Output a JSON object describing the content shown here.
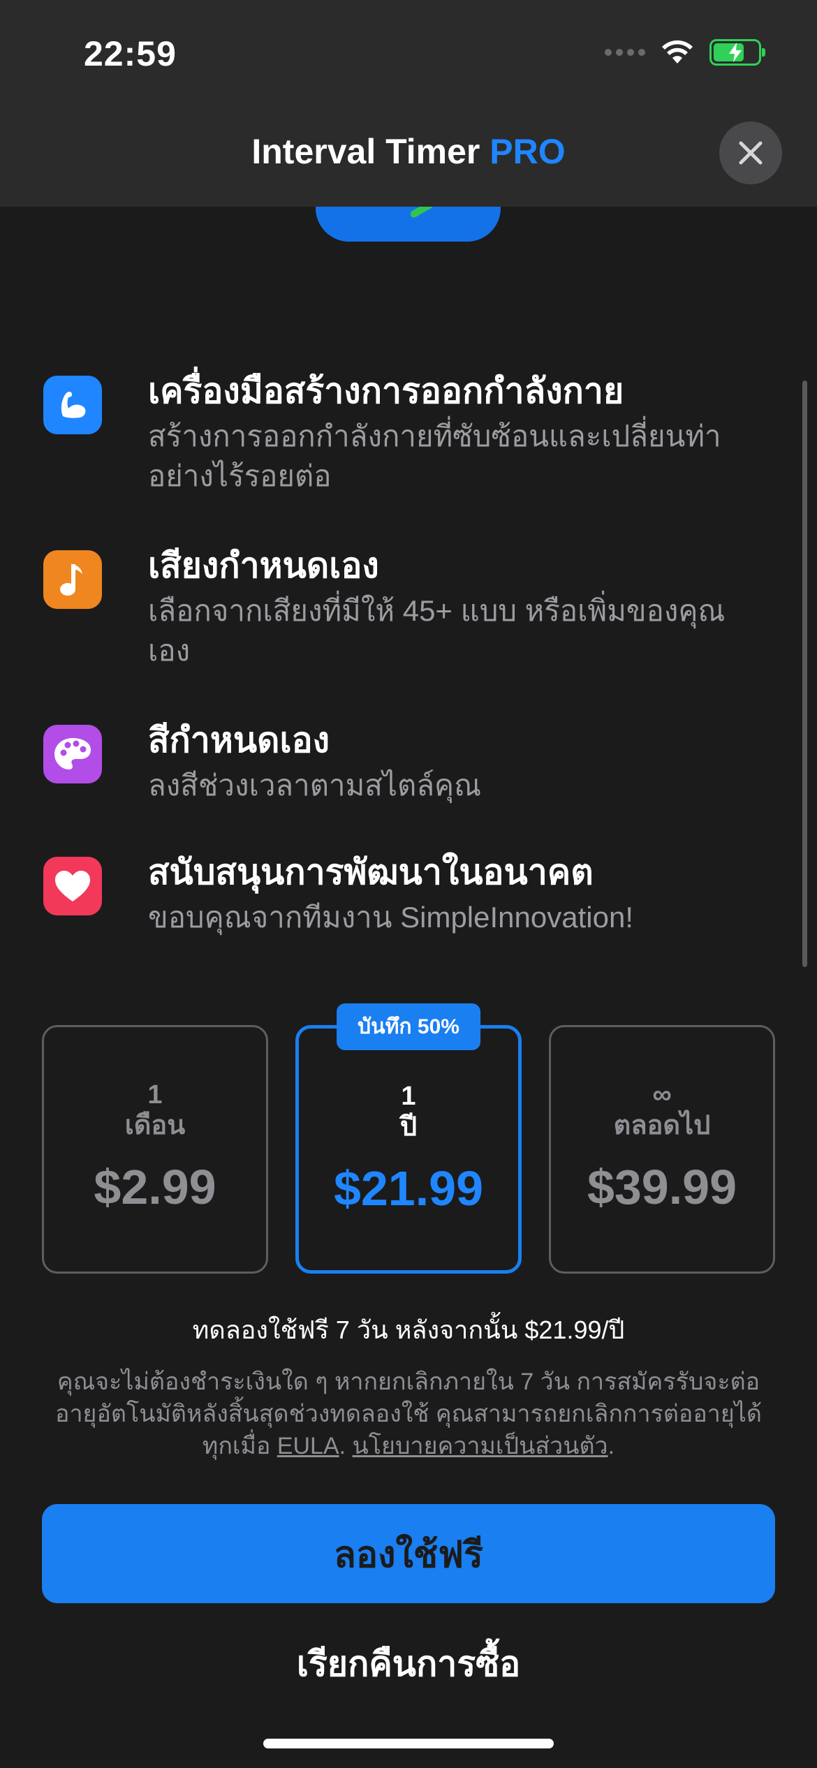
{
  "status_bar": {
    "time": "22:59"
  },
  "nav": {
    "title": "Interval Timer",
    "title_accent": "PRO"
  },
  "features": [
    {
      "icon": "flexed-bicep-icon",
      "color": "#1f86ff",
      "title": "เครื่องมือสร้างการออกกำลังกาย",
      "desc": "สร้างการออกกำลังกายที่ซับซ้อนและเปลี่ยนท่าอย่างไร้รอยต่อ"
    },
    {
      "icon": "music-note-icon",
      "color": "#f0861f",
      "title": "เสียงกำหนดเอง",
      "desc": "เลือกจากเสียงที่มีให้ 45+ แบบ หรือเพิ่มของคุณเอง"
    },
    {
      "icon": "palette-icon",
      "color": "#b24de8",
      "title": "สีกำหนดเอง",
      "desc": "ลงสีช่วงเวลาตามสไตล์คุณ"
    },
    {
      "icon": "heart-icon",
      "color": "#f2395a",
      "title": "สนับสนุนการพัฒนาในอนาคต",
      "desc": "ขอบคุณจากทีมงาน SimpleInnovation!"
    }
  ],
  "plans": [
    {
      "count": "1",
      "period": "เดือน",
      "price": "$2.99"
    },
    {
      "count": "1",
      "period": "ปี",
      "price": "$21.99",
      "badge": "บันทึก 50%"
    },
    {
      "count": "∞",
      "period": "ตลอดไป",
      "price": "$39.99"
    }
  ],
  "selected_plan": 1,
  "trial_text": "ทดลองใช้ฟรี 7 วัน หลังจากนั้น $21.99/ปี",
  "fine_print": {
    "text": "คุณจะไม่ต้องชำระเงินใด ๆ หากยกเลิกภายใน 7 วัน การสมัครรับจะต่ออายุอัตโนมัติหลังสิ้นสุดช่วงทดลองใช้ คุณสามารถยกเลิกการต่ออายุได้ทุกเมื่อ",
    "eula": "EULA",
    "sep": ". ",
    "privacy": "นโยบายความเป็นส่วนตัว",
    "end": "."
  },
  "cta_label": "ลองใช้ฟรี",
  "restore_label": "เรียกคืนการซื้อ",
  "colors": {
    "accent": "#1a7ff0",
    "background": "#1b1b1c",
    "nav_bg": "#2b2b2c",
    "muted": "#8e8e93"
  },
  "battery_level": 0.7
}
